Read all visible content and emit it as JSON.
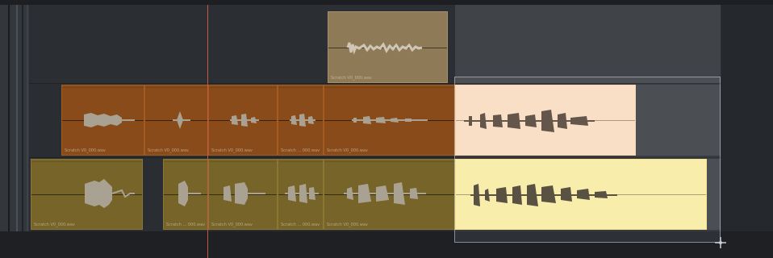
{
  "timeline": {
    "tracks": [
      "video-1",
      "audio-1",
      "audio-2"
    ],
    "clips": {
      "video": {
        "name": "Scratch V0_000.wav"
      },
      "audio1": [
        {
          "name": "Scratch V0_000.wav"
        },
        {
          "name": "Scratch V0_000.wav"
        },
        {
          "name": "Scratch V0_000.wav"
        },
        {
          "name": "Scratch ... 000.wav"
        },
        {
          "name": "Scratch V0_000.wav"
        }
      ],
      "audio2": [
        {
          "name": "Scratch V0_000.wav"
        },
        {
          "name": "Scratch ... 000.wav"
        },
        {
          "name": "Scratch V0_000.wav"
        },
        {
          "name": "Scratch ... 000.wav"
        },
        {
          "name": "Scratch V0_000.wav"
        }
      ]
    },
    "colors": {
      "orange_clip": "#8a4b1a",
      "olive_clip": "#766428",
      "peach_highlight": "#ffe3c3",
      "yellow_highlight": "#fff2a6",
      "playhead": "#c25a45"
    }
  },
  "icons": {
    "cursor": "crosshair-cursor-icon"
  }
}
